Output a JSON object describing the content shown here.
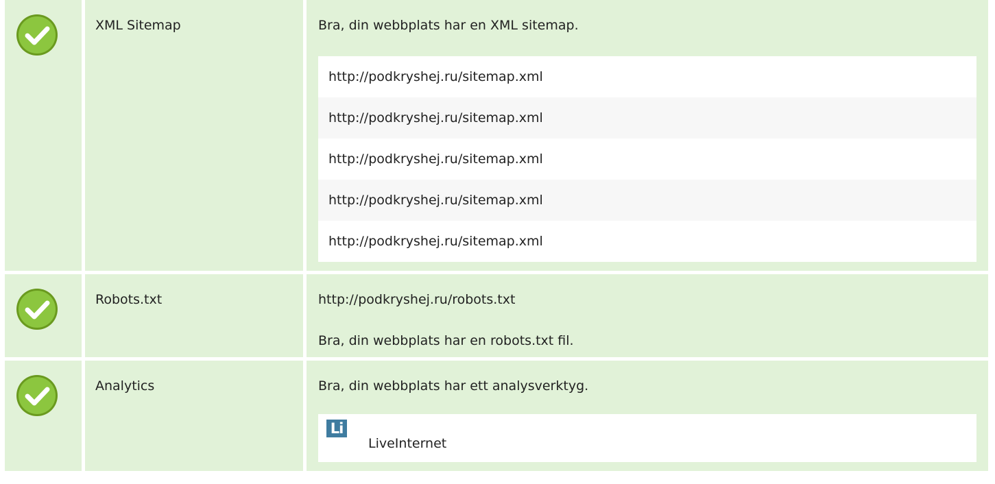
{
  "colors": {
    "row_bg": "#e1f2d8",
    "check_green": "#8cc63f",
    "check_green_dark": "#6a9a1f",
    "logo_bg": "#3f7ca0"
  },
  "rows": [
    {
      "icon": "check-circle-icon",
      "label": "XML Sitemap",
      "message": "Bra, din webbplats har en XML sitemap.",
      "urls": [
        "http://podkryshej.ru/sitemap.xml",
        "http://podkryshej.ru/sitemap.xml",
        "http://podkryshej.ru/sitemap.xml",
        "http://podkryshej.ru/sitemap.xml",
        "http://podkryshej.ru/sitemap.xml"
      ]
    },
    {
      "icon": "check-circle-icon",
      "label": "Robots.txt",
      "url": "http://podkryshej.ru/robots.txt",
      "message": "Bra, din webbplats har en robots.txt fil."
    },
    {
      "icon": "check-circle-icon",
      "label": "Analytics",
      "message": "Bra, din webbplats har ett analysverktyg.",
      "tool": {
        "logo_text": "Li",
        "logo_icon": "liveinternet-logo-icon",
        "name": "LiveInternet"
      }
    }
  ]
}
